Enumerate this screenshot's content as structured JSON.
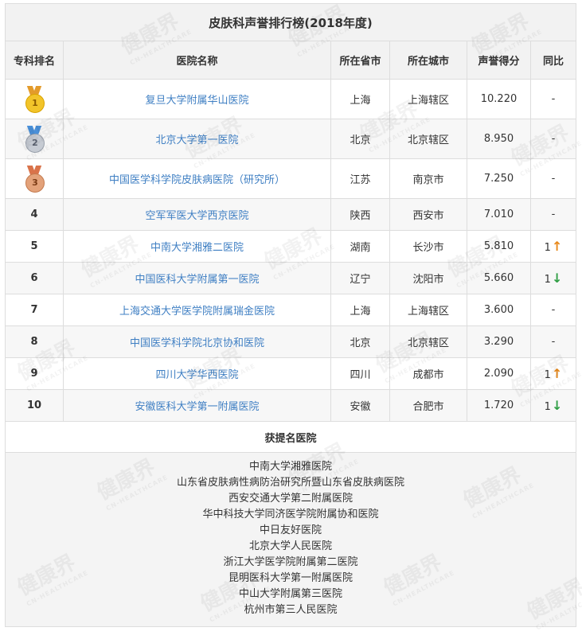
{
  "table": {
    "title": "皮肤科声誉排行榜(2018年度)",
    "headers": {
      "rank": "专科排名",
      "hospital": "医院名称",
      "province": "所在省市",
      "city": "所在城市",
      "score": "声誉得分",
      "yoy": "同比"
    },
    "rows": [
      {
        "rank": "1",
        "medal": "gold-medal-icon",
        "hospital": "复旦大学附属华山医院",
        "province": "上海",
        "city": "上海辖区",
        "score": "10.220",
        "yoy": "-",
        "trend": ""
      },
      {
        "rank": "2",
        "medal": "silver-medal-icon",
        "hospital": "北京大学第一医院",
        "province": "北京",
        "city": "北京辖区",
        "score": "8.950",
        "yoy": "-",
        "trend": ""
      },
      {
        "rank": "3",
        "medal": "bronze-medal-icon",
        "hospital": "中国医学科学院皮肤病医院（研究所）",
        "province": "江苏",
        "city": "南京市",
        "score": "7.250",
        "yoy": "-",
        "trend": ""
      },
      {
        "rank": "4",
        "hospital": "空军军医大学西京医院",
        "province": "陕西",
        "city": "西安市",
        "score": "7.010",
        "yoy": "-",
        "trend": ""
      },
      {
        "rank": "5",
        "hospital": "中南大学湘雅二医院",
        "province": "湖南",
        "city": "长沙市",
        "score": "5.810",
        "yoy": "1",
        "trend": "up"
      },
      {
        "rank": "6",
        "hospital": "中国医科大学附属第一医院",
        "province": "辽宁",
        "city": "沈阳市",
        "score": "5.660",
        "yoy": "1",
        "trend": "down"
      },
      {
        "rank": "7",
        "hospital": "上海交通大学医学院附属瑞金医院",
        "province": "上海",
        "city": "上海辖区",
        "score": "3.600",
        "yoy": "-",
        "trend": ""
      },
      {
        "rank": "8",
        "hospital": "中国医学科学院北京协和医院",
        "province": "北京",
        "city": "北京辖区",
        "score": "3.290",
        "yoy": "-",
        "trend": ""
      },
      {
        "rank": "9",
        "hospital": "四川大学华西医院",
        "province": "四川",
        "city": "成都市",
        "score": "2.090",
        "yoy": "1",
        "trend": "up"
      },
      {
        "rank": "10",
        "hospital": "安徽医科大学第一附属医院",
        "province": "安徽",
        "city": "合肥市",
        "score": "1.720",
        "yoy": "1",
        "trend": "down"
      }
    ],
    "arrows": {
      "up": "🡡",
      "down": "🡣"
    },
    "nominated": {
      "title": "获提名医院",
      "items": [
        "中南大学湘雅医院",
        "山东省皮肤病性病防治研究所暨山东省皮肤病医院",
        "西安交通大学第二附属医院",
        "华中科技大学同济医学院附属协和医院",
        "中日友好医院",
        "北京大学人民医院",
        "浙江大学医学院附属第二医院",
        "昆明医科大学第一附属医院",
        "中山大学附属第三医院",
        "杭州市第三人民医院"
      ]
    }
  },
  "watermark": {
    "text": "健康界",
    "sub": "CN-HEALTHCARE"
  },
  "colors": {
    "link": "#3f7fc3",
    "up": "#e8891b",
    "down": "#2f9e44",
    "header_bg": "#f2f2f2"
  }
}
